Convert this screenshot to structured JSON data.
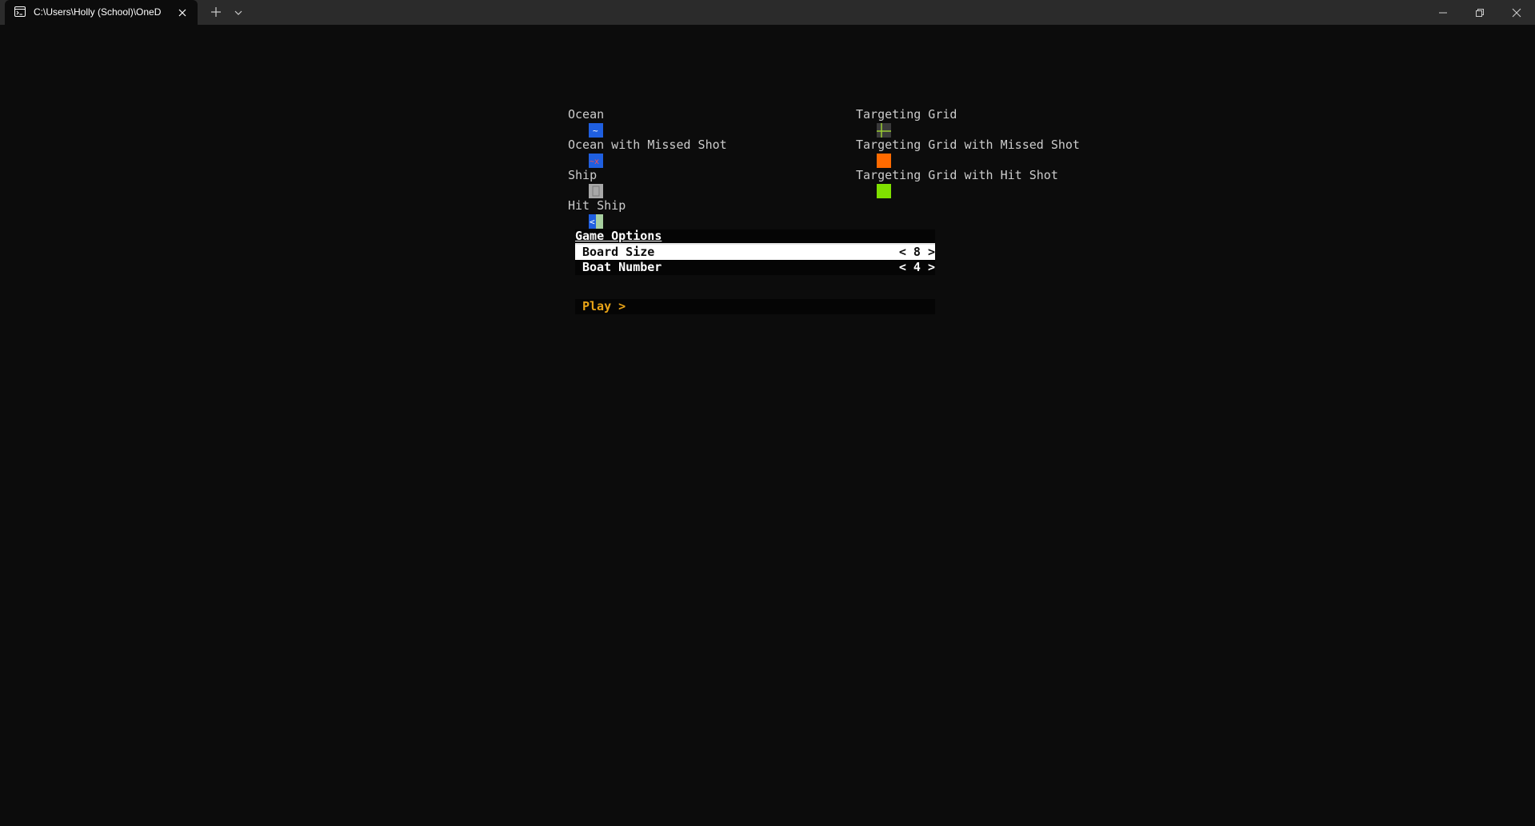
{
  "window": {
    "tab_title": "C:\\Users\\Holly (School)\\OneD"
  },
  "legend": {
    "ocean": "Ocean",
    "ocean_missed": "Ocean with Missed Shot",
    "ship": "Ship",
    "hit_ship": "Hit Ship",
    "targeting_grid": "Targeting Grid",
    "targeting_missed": "Targeting Grid with Missed Shot",
    "targeting_hit": "Targeting Grid with Hit Shot",
    "ocean_glyph": "~",
    "ocean_missed_glyph": "~x",
    "hit_ship_glyph": "<"
  },
  "menu": {
    "header": "Game Options",
    "board_size_label": "Board Size",
    "board_size_value": "< 8 >",
    "boat_number_label": "Boat Number",
    "boat_number_value": "< 4 >",
    "play_label": "Play >"
  },
  "colors": {
    "ocean": "#1f5fe0",
    "ship": "#a8a8a8",
    "targeting_grid": "#5a5a5a",
    "targeting_missed": "#ff6a00",
    "targeting_hit": "#7fe000",
    "play": "#e8a317"
  }
}
